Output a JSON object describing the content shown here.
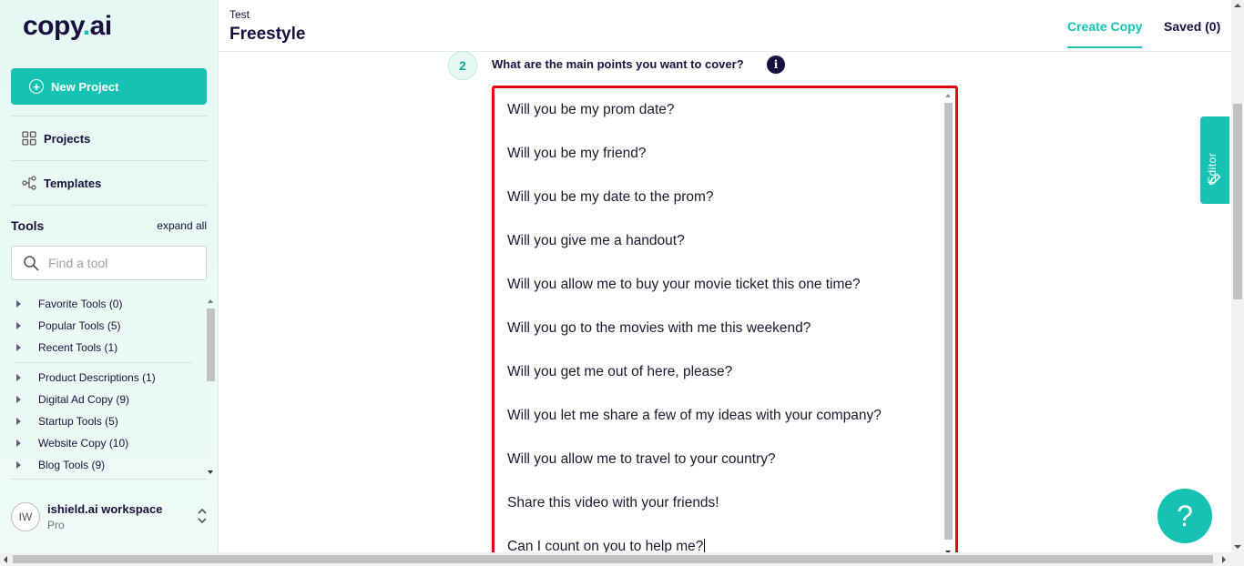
{
  "brand": {
    "logo_main": "copy",
    "logo_dot": ".",
    "logo_tail": "ai",
    "accent": "#16c2b4",
    "alert_border": "#e4000f"
  },
  "sidebar": {
    "new_project": "New Project",
    "nav": [
      {
        "label": "Projects"
      },
      {
        "label": "Templates"
      }
    ],
    "tools_title": "Tools",
    "expand_all": "expand all",
    "search_placeholder": "Find a tool",
    "tool_groups_top": [
      {
        "label": "Favorite Tools (0)"
      },
      {
        "label": "Popular Tools (5)"
      },
      {
        "label": "Recent Tools (1)"
      }
    ],
    "tool_groups": [
      {
        "label": "Product Descriptions (1)"
      },
      {
        "label": "Digital Ad Copy (9)"
      },
      {
        "label": "Startup Tools (5)"
      },
      {
        "label": "Website Copy (10)"
      },
      {
        "label": "Blog Tools (9)"
      }
    ],
    "workspace": {
      "initials": "IW",
      "name": "ishield.ai workspace",
      "plan": "Pro"
    }
  },
  "header": {
    "breadcrumb": "Test",
    "title": "Freestyle",
    "tabs": [
      {
        "label": "Create Copy"
      },
      {
        "label": "Saved (0)"
      }
    ]
  },
  "main": {
    "step_number": "2",
    "question": "What are the main points you want to cover?",
    "info_glyph": "i",
    "lines": [
      "Will you be my prom date?",
      "Will you be my friend?",
      "Will you be my date to the prom?",
      "Will you give me a handout?",
      "Will you allow me to buy your movie ticket this one time?",
      "Will you go to the movies with me this weekend?",
      "Will you get me out of here, please?",
      "Will you let me share a few of my ideas with your company?",
      "Will you allow me to travel to your country?",
      "Share this video with your friends!",
      "Can I count on you to help me?"
    ]
  },
  "editor_tab": {
    "label": "Editor"
  },
  "help": {
    "glyph": "?"
  }
}
